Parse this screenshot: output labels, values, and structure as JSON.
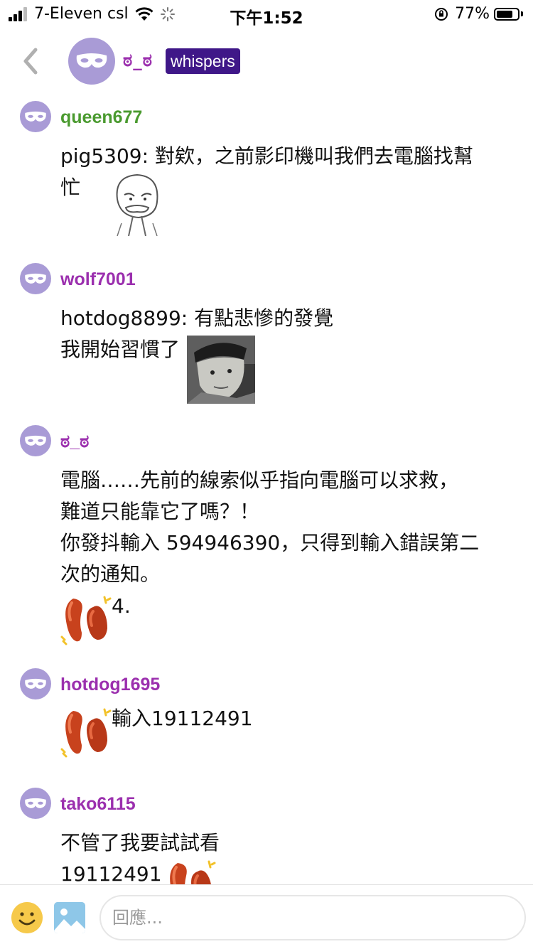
{
  "status_bar": {
    "carrier": "7-Eleven csl",
    "time": "下午1:52",
    "battery_percent": "77%",
    "battery_level": 0.77
  },
  "header": {
    "back_icon": "chevron-left-icon",
    "avatar_icon": "mask-icon",
    "name": "ಠ_ಠ",
    "badge": "whispers",
    "colors": {
      "badge_bg": "#3f1788",
      "name": "#9b2fae",
      "avatar_bg": "#a99bd6"
    }
  },
  "posts": [
    {
      "author": "queen677",
      "author_color": "#4a9a2f",
      "lines": [
        "pig5309: 對欸，之前影印機叫我們去電腦找幫",
        "忙"
      ],
      "image": "sketch-meme"
    },
    {
      "author": "wolf7001",
      "author_color": "#9b2fae",
      "lines": [
        "hotdog8899: 有點悲慘的發覺",
        "我開始習慣了"
      ],
      "image": "photo-meme"
    },
    {
      "author": "ಠ_ಠ",
      "author_color": "#9b2fae",
      "lines": [
        "電腦……先前的線索似乎指向電腦可以求救，",
        "難道只能靠它了嗎？！",
        "你發抖輸入 594946390，只得到輸入錯誤第二",
        "次的通知。"
      ],
      "sticker": "sausage-sticker",
      "sticker_text": "4."
    },
    {
      "author": "hotdog1695",
      "author_color": "#9b2fae",
      "sticker": "sausage-sticker",
      "sticker_text": "輸入19112491"
    },
    {
      "author": "tako6115",
      "author_color": "#9b2fae",
      "lines": [
        "不管了我要試試看"
      ],
      "inline_text": "19112491",
      "sticker": "sausage-sticker"
    }
  ],
  "bottom_bar": {
    "emoji_icon": "smiley-icon",
    "image_icon": "image-icon",
    "reply_placeholder": "回應..."
  }
}
